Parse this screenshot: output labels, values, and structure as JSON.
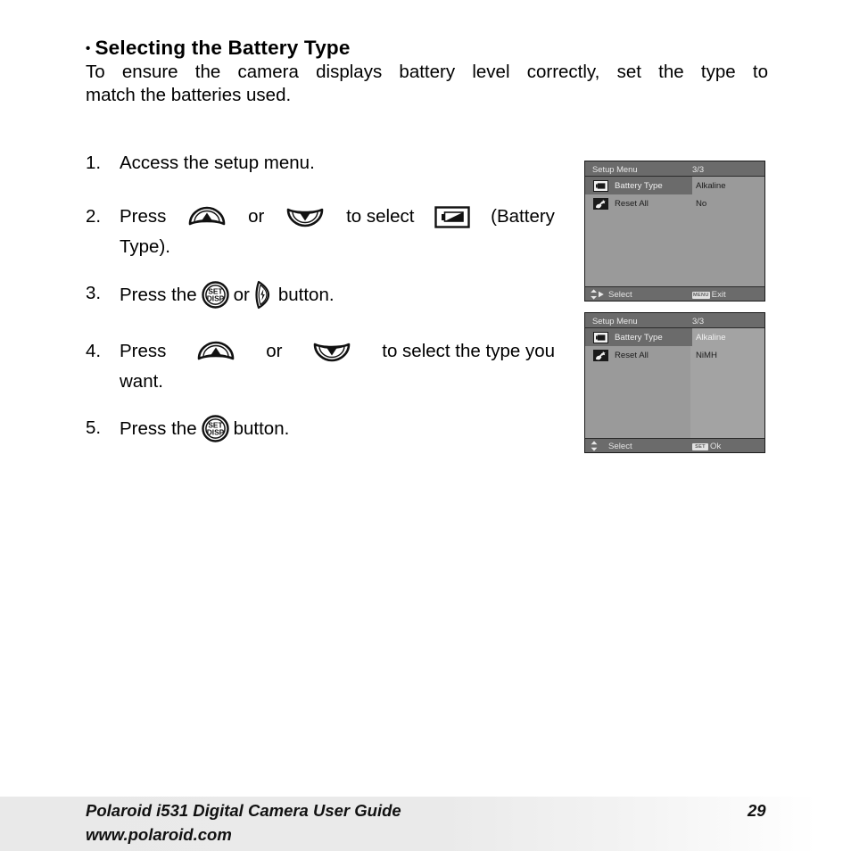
{
  "document": {
    "heading_bullet": "•",
    "heading": "Selecting the Battery Type",
    "intro_line1": "To ensure the camera displays battery level correctly, set the type to",
    "intro_line2": "match the batteries used."
  },
  "steps": [
    {
      "number": "1.",
      "text": "Access the setup menu."
    },
    {
      "number": "2.",
      "press_label": "Press",
      "or_label": "or",
      "to_select_label": "to  select",
      "tail": "(Battery",
      "line2": "Type).",
      "icons": [
        "up-button-icon",
        "down-button-icon",
        "battery-type-icon"
      ]
    },
    {
      "number": "3.",
      "press_label": "Press the",
      "or_label": "or",
      "tail": "button.",
      "icons": [
        "set-disp-button-icon",
        "flash-button-icon"
      ]
    },
    {
      "number": "4.",
      "press_label": "Press",
      "or_label": "or",
      "to_select_label": "to  select  the  type  you",
      "line2": "want.",
      "icons": [
        "up-button-icon",
        "down-button-icon"
      ]
    },
    {
      "number": "5.",
      "press_label": "Press the",
      "tail": "button.",
      "icons": [
        "set-disp-button-icon"
      ]
    }
  ],
  "lcd_screens": [
    {
      "id": "setup-menu-screen-1",
      "title": "Setup Menu",
      "page_indicator": "3/3",
      "rows": [
        {
          "icon": "battery-type-icon",
          "label": "Battery Type",
          "value": "Alkaline",
          "selected": true
        },
        {
          "icon": "reset-all-icon",
          "label": "Reset All",
          "value": "No",
          "selected": false
        }
      ],
      "status_left": "Select",
      "status_right": "Exit",
      "status_right_badge": "MENU",
      "status_left_arrows": "up-down-right-arrows-icon"
    },
    {
      "id": "setup-menu-screen-2",
      "title": "Setup Menu",
      "page_indicator": "3/3",
      "rows": [
        {
          "icon": "battery-type-icon",
          "label": "Battery Type",
          "value": "Alkaline",
          "selected": true,
          "value_highlighted": true
        },
        {
          "icon": "reset-all-icon",
          "label": "Reset All",
          "value": "NiMH",
          "selected": false
        }
      ],
      "status_left": "Select",
      "status_right": "Ok",
      "status_right_badge": "SET",
      "status_left_arrows": "up-down-arrows-icon"
    }
  ],
  "footer": {
    "line1": "Polaroid i531 Digital Camera User Guide",
    "line2": "www.polaroid.com",
    "page_number": "29"
  },
  "colors": {
    "lcd_background": "#9a9a9a",
    "lcd_bar": "#6b6b6b",
    "lcd_value_column": "#a3a3a3",
    "lcd_text": "#1c1c1c",
    "lcd_text_highlight": "#efefef",
    "footer_band": "#e9e9e9",
    "page_text": "#000000"
  }
}
